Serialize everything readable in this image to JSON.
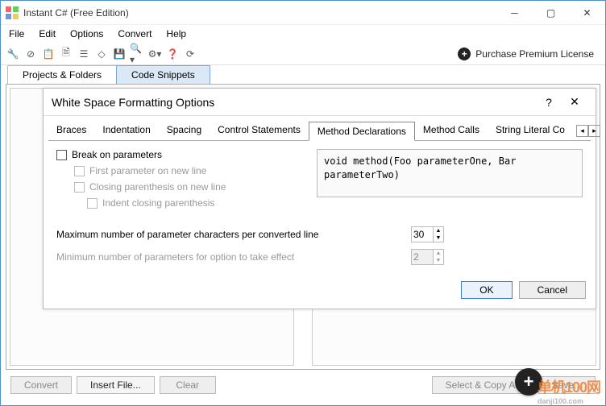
{
  "window": {
    "title": "Instant C# (Free Edition)"
  },
  "menu": {
    "file": "File",
    "edit": "Edit",
    "options": "Options",
    "convert": "Convert",
    "help": "Help"
  },
  "purchase": {
    "label": "Purchase Premium License"
  },
  "main_tabs": {
    "projects": "Projects & Folders",
    "snippets": "Code Snippets"
  },
  "buttons": {
    "convert": "Convert",
    "insert_file": "Insert File...",
    "clear": "Clear",
    "select_copy": "Select & Copy All",
    "save": "Save..."
  },
  "dialog": {
    "title": "White Space Formatting Options",
    "tabs": {
      "braces": "Braces",
      "indentation": "Indentation",
      "spacing": "Spacing",
      "control": "Control Statements",
      "method_decl": "Method Declarations",
      "method_calls": "Method Calls",
      "string_literal": "String Literal Co"
    },
    "break_params": "Break on parameters",
    "first_new_line": "First parameter on new line",
    "closing_new_line": "Closing parenthesis on new line",
    "indent_closing": "Indent closing parenthesis",
    "preview": "void method(Foo parameterOne, Bar parameterTwo)",
    "max_chars_label": "Maximum number of parameter characters per converted line",
    "max_chars_value": "30",
    "min_params_label": "Minimum number of parameters for option to take effect",
    "min_params_value": "2",
    "ok": "OK",
    "cancel": "Cancel"
  },
  "watermark": {
    "line1": "单机100网",
    "line2": "danji100.com"
  }
}
